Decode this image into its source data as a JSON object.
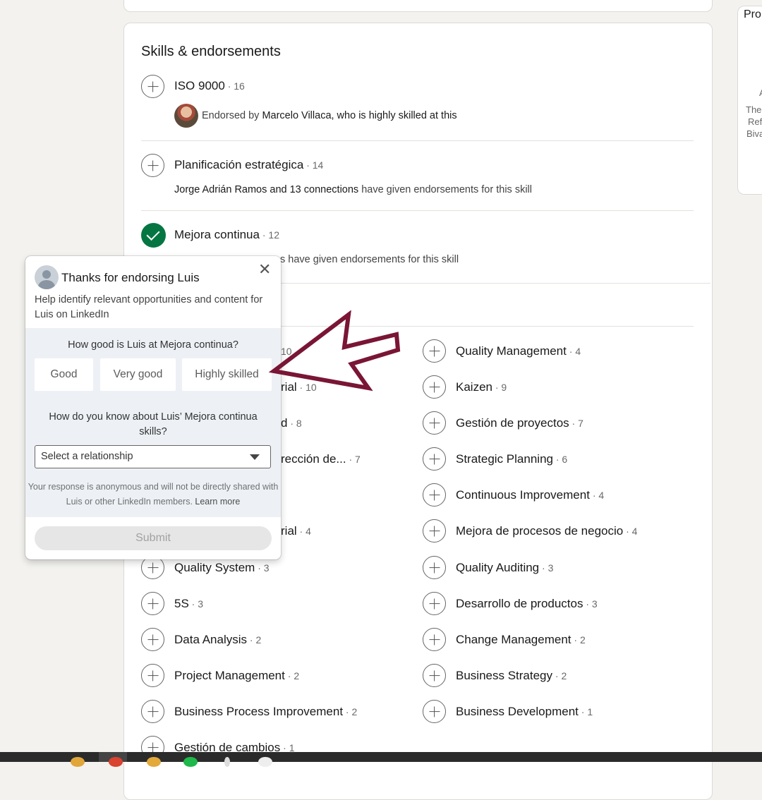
{
  "section_title": "Skills & endorsements",
  "top_skills": [
    {
      "name": "ISO 9000",
      "count": " · 16",
      "state": "plus"
    },
    {
      "name": "Planificación estratégica",
      "count": " · 14",
      "state": "plus"
    },
    {
      "name": "Mejora continua",
      "count": " · 12",
      "state": "endorsed"
    }
  ],
  "endorse_1": {
    "pre": "Endorsed by ",
    "name": "Marcelo Villaca, who is highly skilled at this"
  },
  "endorse_2": {
    "name": "Jorge Adrián Ramos and 13 connections",
    "post": " have given endorsements for this skill"
  },
  "endorse_3": {
    "visible": "s have given endorsements for this skill"
  },
  "left_skills_partial": [
    {
      "frag": "",
      "count": "10"
    },
    {
      "frag": "rial",
      "count": " · 10"
    },
    {
      "frag": "d",
      "count": " · 8"
    },
    {
      "frag": "rección de...",
      "count": " · 7"
    },
    {
      "frag": "rial",
      "count": " · 4"
    }
  ],
  "left_skills": [
    {
      "name": "Quality System",
      "count": " · 3"
    },
    {
      "name": "5S",
      "count": " · 3"
    },
    {
      "name": "Data Analysis",
      "count": " · 2"
    },
    {
      "name": "Project Management",
      "count": " · 2"
    },
    {
      "name": "Business Process Improvement",
      "count": " · 2"
    },
    {
      "name": "Gestión de cambios",
      "count": " · 1"
    }
  ],
  "right_skills": [
    {
      "name": "Quality Management",
      "count": " · 4"
    },
    {
      "name": "Kaizen",
      "count": " · 9"
    },
    {
      "name": "Gestión de proyectos",
      "count": " · 7"
    },
    {
      "name": "Strategic Planning",
      "count": " · 6"
    },
    {
      "name": "Continuous Improvement",
      "count": " · 4"
    },
    {
      "name": "Mejora de procesos de negocio",
      "count": " · 4"
    },
    {
      "name": "Quality Auditing",
      "count": " · 3"
    },
    {
      "name": "Desarrollo de productos",
      "count": " · 3"
    },
    {
      "name": "Change Management",
      "count": " · 2"
    },
    {
      "name": "Business Strategy",
      "count": " · 2"
    },
    {
      "name": "Business Development",
      "count": " · 1"
    }
  ],
  "popup": {
    "title": "Thanks for endorsing Luis",
    "close": "✕",
    "description": "Help identify relevant opportunities and content for Luis on LinkedIn",
    "question1": "How good is Luis at Mejora continua?",
    "ratings": [
      "Good",
      "Very good",
      "Highly skilled"
    ],
    "question2": "How do you know about Luis’ Mejora continua skills?",
    "select_placeholder": "Select a relationship",
    "note": "Your response is anonymous and will not be directly shared with Luis or other LinkedIn members.",
    "learn_more": "Learn more",
    "submit": "Submit"
  },
  "side_panel": {
    "heading": "Pro",
    "line1": "A",
    "line2": "The",
    "line3": "Refe",
    "line4": "Biva"
  },
  "colors": {
    "arrow": "#7a1535",
    "endorsed_check": "#057642"
  }
}
